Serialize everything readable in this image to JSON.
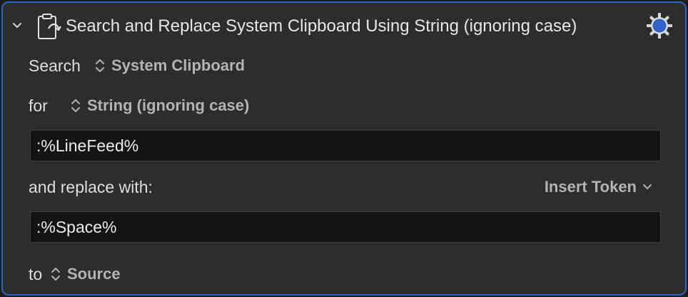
{
  "action": {
    "title": "Search and Replace System Clipboard Using String (ignoring case)",
    "accent_color": "#2f63c9"
  },
  "search_row": {
    "label": "Search",
    "target": "System Clipboard"
  },
  "for_row": {
    "label": "for",
    "match_type": "String (ignoring case)"
  },
  "search_field": {
    "value": ":%LineFeed%"
  },
  "replace_row": {
    "label": "and replace with:",
    "insert_token_label": "Insert Token"
  },
  "replace_field": {
    "value": ":%Space%"
  },
  "to_row": {
    "label": "to",
    "destination": "Source"
  },
  "icons": {
    "disclosure": "chevron-down-icon",
    "action": "clipboard-icon",
    "settings": "gear-icon"
  }
}
